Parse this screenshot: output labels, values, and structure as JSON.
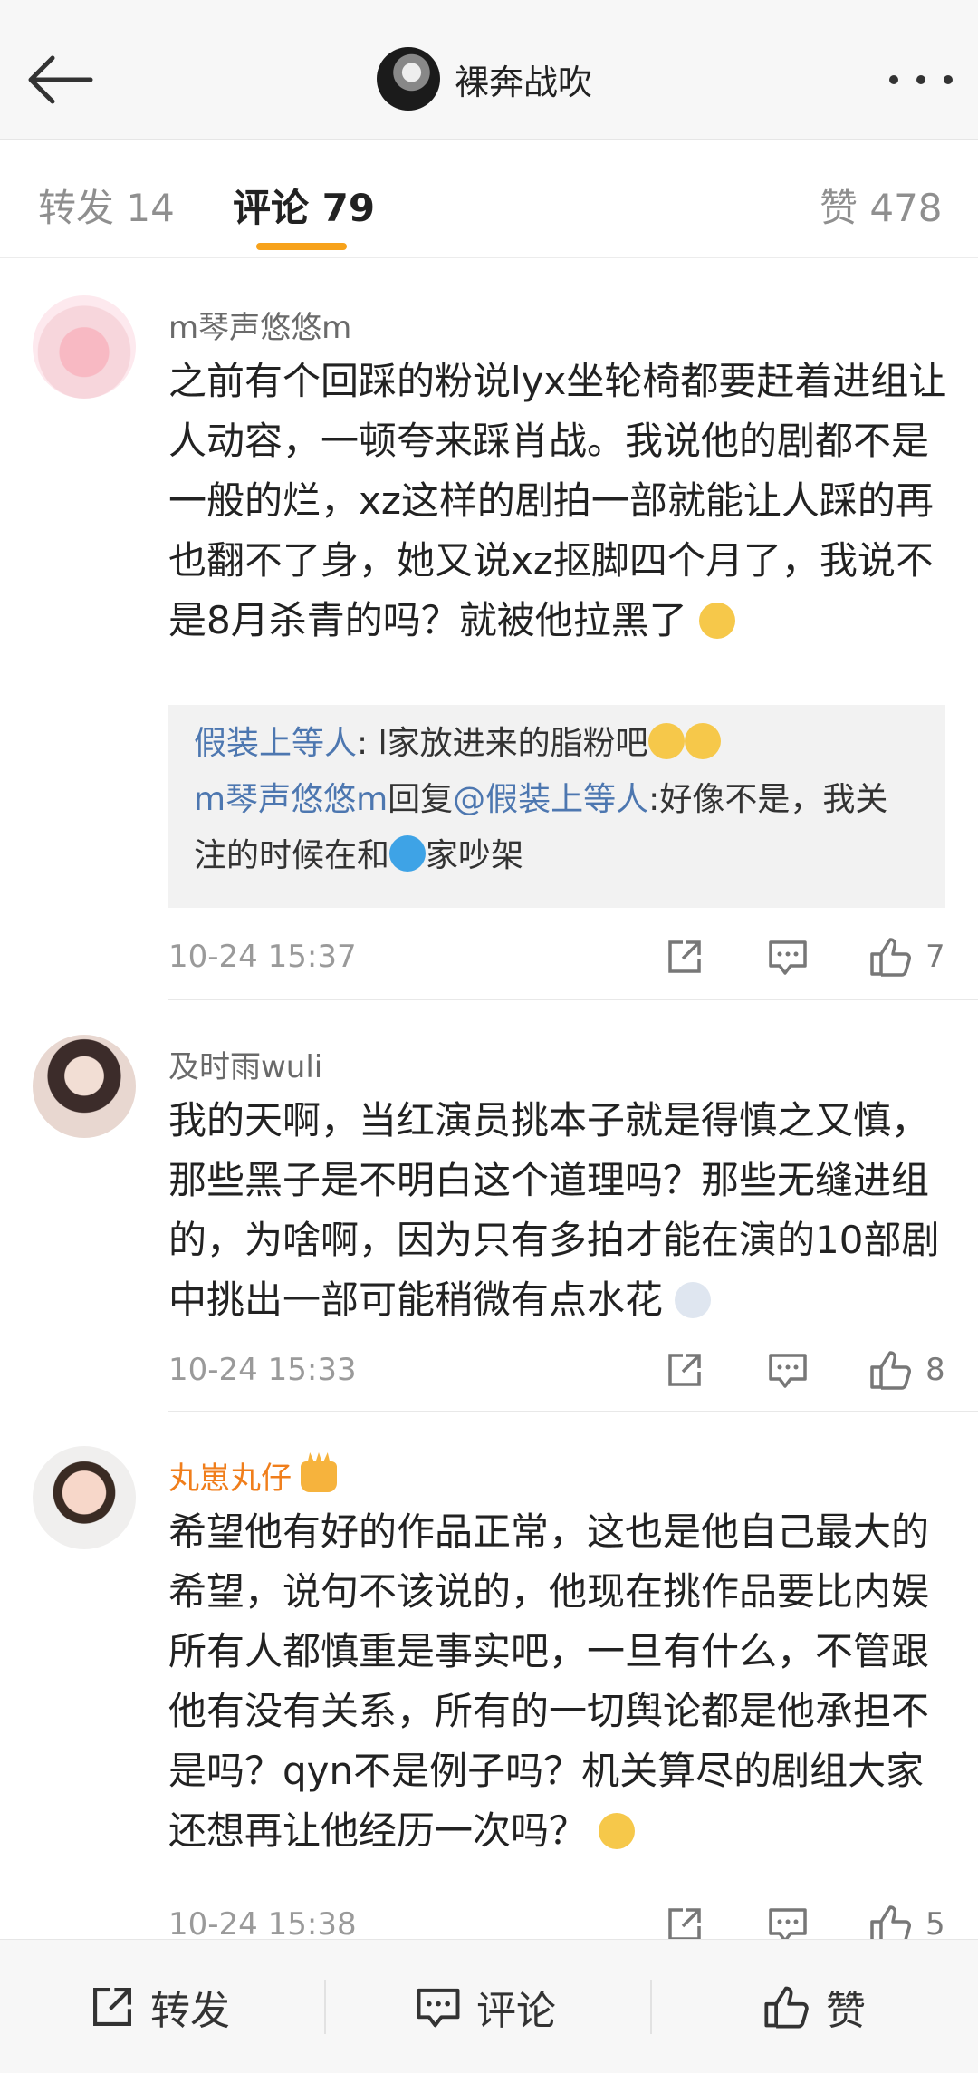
{
  "header": {
    "title": "裸奔战吹",
    "icons": {
      "back": "back-arrow-icon",
      "more": "more-dots-icon"
    }
  },
  "tabs": [
    {
      "label": "转发 14"
    },
    {
      "label": "评论 79"
    },
    {
      "label": "赞 478"
    }
  ],
  "comments": [
    {
      "user": "m琴声悠悠m",
      "text": "之前有个回踩的粉说lyx坐轮椅都要赶着进组让人动容，一顿夸来踩肖战。我说他的剧都不是一般的烂，xz这样的剧拍一部就能让人踩的再也翻不了身，她又说xz抠脚四个月了，我说不是8月杀青的吗？就被他拉黑了",
      "replies": [
        {
          "name": "假装上等人",
          "sep": ": ",
          "text": "l家放进来的脂粉吧"
        },
        {
          "name": "m琴声悠悠m",
          "mid": "回复",
          "mention": "@假装上等人",
          "sep": ":",
          "text": "好像不是，我关注的时候在和",
          "after": "家吵架"
        }
      ],
      "time": "10-24 15:37",
      "likes": "7"
    },
    {
      "user": "及时雨wuli",
      "text": "我的天啊，当红演员挑本子就是得慎之又慎，那些黑子是不明白这个道理吗？那些无缝进组的，为啥啊，因为只有多拍才能在演的10部剧中挑出一部可能稍微有点水花",
      "time": "10-24 15:33",
      "likes": "8"
    },
    {
      "user": "丸崽丸仔",
      "text": "希望他有好的作品正常，这也是他自己最大的希望，说句不该说的，他现在挑作品要比内娱所有人都慎重是事实吧，一旦有什么，不管跟他有没有关系，所有的一切舆论都是他承担不是吗？qyn不是例子吗？机关算尽的剧组大家还想再让他经历一次吗？",
      "time": "10-24 15:38",
      "likes": "5"
    }
  ],
  "bottom_bar": {
    "repost": "转发",
    "comment": "评论",
    "like": "赞"
  },
  "colors": {
    "accent": "#f7a21b",
    "link": "#4d77b0",
    "vip": "#f07e1b"
  }
}
